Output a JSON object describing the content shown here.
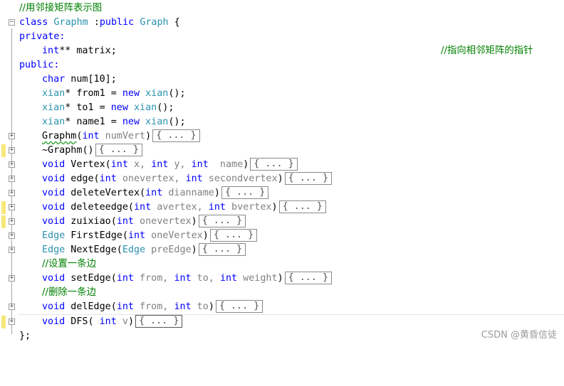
{
  "comments": {
    "header": "//用邻接矩阵表示图",
    "matrix_note": "//指向相邻矩阵的指针",
    "set_edge": "//设置一条边",
    "del_edge": "//删除一条边"
  },
  "class_decl": {
    "kw_class": "class",
    "name": "Graphm",
    "sep": " :",
    "kw_public": "public",
    "base": "Graph",
    "brace": " {"
  },
  "access": {
    "private": "private:",
    "public": "public:"
  },
  "members": {
    "matrix": {
      "type": "int",
      "rest": "** matrix;"
    },
    "num": {
      "type": "char",
      "rest": " num[10];"
    },
    "from1": {
      "type": "xian",
      "rest": "* from1 = ",
      "kw_new": "new",
      "ctor": "xian",
      "end": "();"
    },
    "to1": {
      "type": "xian",
      "rest": "* to1 = ",
      "kw_new": "new",
      "ctor": "xian",
      "end": "();"
    },
    "name1": {
      "type": "xian",
      "rest": "* name1 = ",
      "kw_new": "new",
      "ctor": "xian",
      "end": "();"
    }
  },
  "methods": {
    "ctor": {
      "name": "Graphm",
      "open": "(",
      "p1t": "int",
      "p1n": " numVert",
      "close": ")"
    },
    "dtor": {
      "name": "~Graphm",
      "sig": "()"
    },
    "vertex": {
      "ret": "void",
      "name": " Vertex(",
      "p1t": "int",
      "p1n": " x, ",
      "p2t": "int",
      "p2n": " y, ",
      "p3t": "int",
      "p3n": "  name",
      "close": ")"
    },
    "edge": {
      "ret": "void",
      "name": " edge(",
      "p1t": "int",
      "p1n": " onevertex, ",
      "p2t": "int",
      "p2n": " secondvertex",
      "close": ")"
    },
    "delete_vertex": {
      "ret": "void",
      "name": " deleteVertex(",
      "p1t": "int",
      "p1n": " dianname",
      "close": ")"
    },
    "delete_edge": {
      "ret": "void",
      "name": " deleteedge(",
      "p1t": "int",
      "p1n": " avertex, ",
      "p2t": "int",
      "p2n": " bvertex",
      "close": ")"
    },
    "zuixiao": {
      "ret": "void",
      "name": " zuixiao(",
      "p1t": "int",
      "p1n": " onevertex",
      "close": ")"
    },
    "first_edge": {
      "ret": "Edge",
      "name": " FirstEdge(",
      "p1t": "int",
      "p1n": " oneVertex",
      "close": ")"
    },
    "next_edge": {
      "ret": "Edge",
      "name": " NextEdge(",
      "p1t": "Edge",
      "p1n": " preEdge",
      "close": ")"
    },
    "set_edge": {
      "ret": "void",
      "name": " setEdge(",
      "p1t": "int",
      "p1n": " from, ",
      "p2t": "int",
      "p2n": " to, ",
      "p3t": "int",
      "p3n": " weight",
      "close": ")"
    },
    "del_edge": {
      "ret": "void",
      "name": " delEdge(",
      "p1t": "int",
      "p1n": " from, ",
      "p2t": "int",
      "p2n": " to",
      "close": ")"
    },
    "dfs": {
      "ret": "void",
      "name": " DFS( ",
      "p1t": "int",
      "p1n": " v",
      "close": ")"
    }
  },
  "collapsed_label": "{ ... }",
  "fold": {
    "expanded": "−",
    "collapsed": "+"
  },
  "closing": "};",
  "watermark": "CSDN @黄昏信徒",
  "colors": {
    "keyword": "#0000ff",
    "type": "#2b91af",
    "comment": "#008000",
    "param": "#808080",
    "change_marker": "#f6e87a"
  }
}
